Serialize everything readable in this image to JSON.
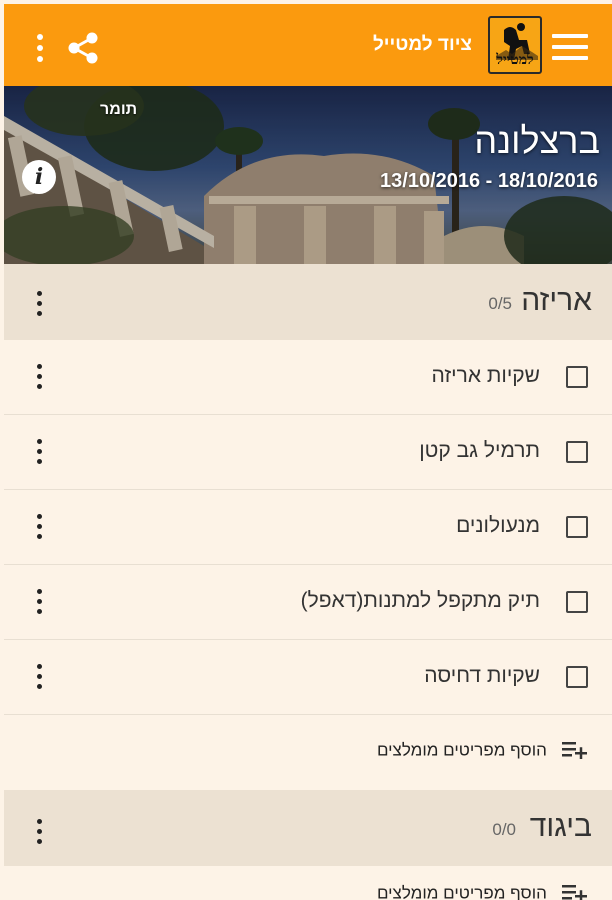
{
  "app": {
    "title": "ציוד למטייל",
    "logo_text": "למטייל"
  },
  "trip": {
    "name": "ברצלונה",
    "dates": "13/10/2016 - 18/10/2016",
    "photo_credit": "תומר"
  },
  "sections": [
    {
      "title": "אריזה",
      "count": "0/5",
      "items": [
        {
          "label": "שקיות אריזה",
          "checked": false
        },
        {
          "label": "תרמיל גב קטן",
          "checked": false
        },
        {
          "label": "מנעולונים",
          "checked": false
        },
        {
          "label": "תיק מתקפל למתנות(דאפל)",
          "checked": false
        },
        {
          "label": "שקיות דחיסה",
          "checked": false
        }
      ],
      "add_label": "הוסף מפריטים מומלצים"
    },
    {
      "title": "ביגוד",
      "count": "0/0",
      "items": [],
      "add_label": "הוסף מפריטים מומלצים"
    }
  ],
  "colors": {
    "accent": "#fb9a0e",
    "background": "#fdf3e7",
    "section_header": "#ece1d2"
  },
  "icons": {
    "menu": "hamburger-icon",
    "share": "share-icon",
    "more": "more-vertical-icon",
    "info": "info-icon",
    "add": "playlist-add-icon"
  }
}
